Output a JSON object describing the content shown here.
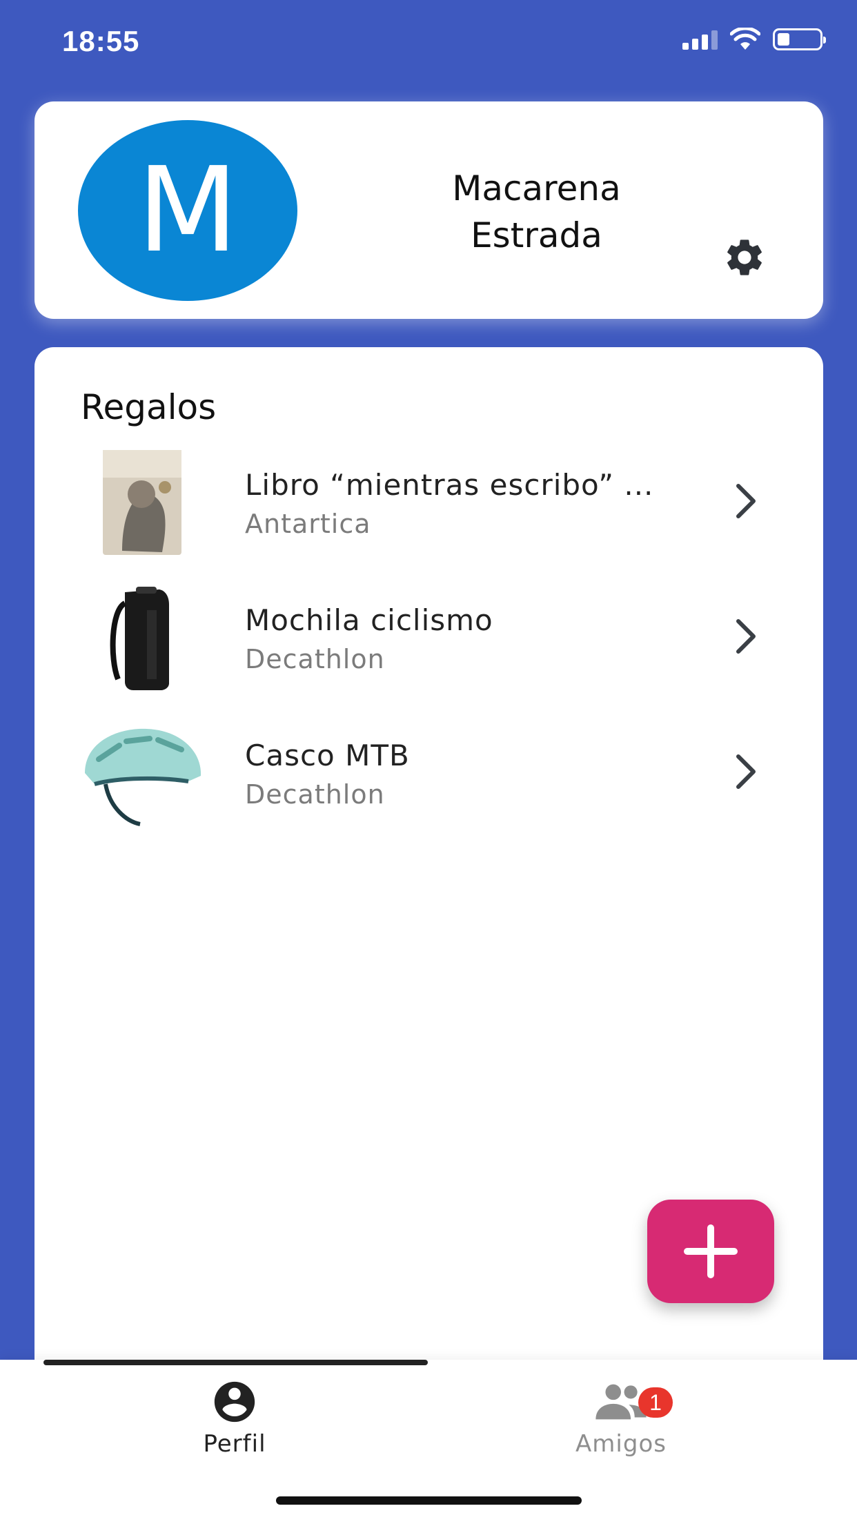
{
  "status_bar": {
    "time": "18:55",
    "icons": [
      "cellular-signal-icon",
      "wifi-icon",
      "battery-icon"
    ],
    "battery_level": 0.3
  },
  "profile": {
    "avatar_letter": "M",
    "avatar_color": "#0a86d4",
    "name_line1": "Macarena",
    "name_line2": "Estrada",
    "settings_icon": "gear-icon"
  },
  "gifts": {
    "title": "Regalos",
    "items": [
      {
        "name": "Libro “mientras escribo” ...",
        "store": "Antartica",
        "image": "book-cover-image"
      },
      {
        "name": "Mochila ciclismo",
        "store": "Decathlon",
        "image": "backpack-image"
      },
      {
        "name": "Casco MTB",
        "store": "Decathlon",
        "image": "helmet-image"
      }
    ]
  },
  "fab": {
    "icon": "plus-icon",
    "color": "#d72a73"
  },
  "bottom_nav": {
    "tabs": [
      {
        "label": "Perfil",
        "icon": "user-circle-icon",
        "active": true
      },
      {
        "label": "Amigos",
        "icon": "group-icon",
        "badge": "1",
        "active": false
      }
    ]
  },
  "colors": {
    "background": "#3e59bf",
    "badge": "#e8352c"
  }
}
